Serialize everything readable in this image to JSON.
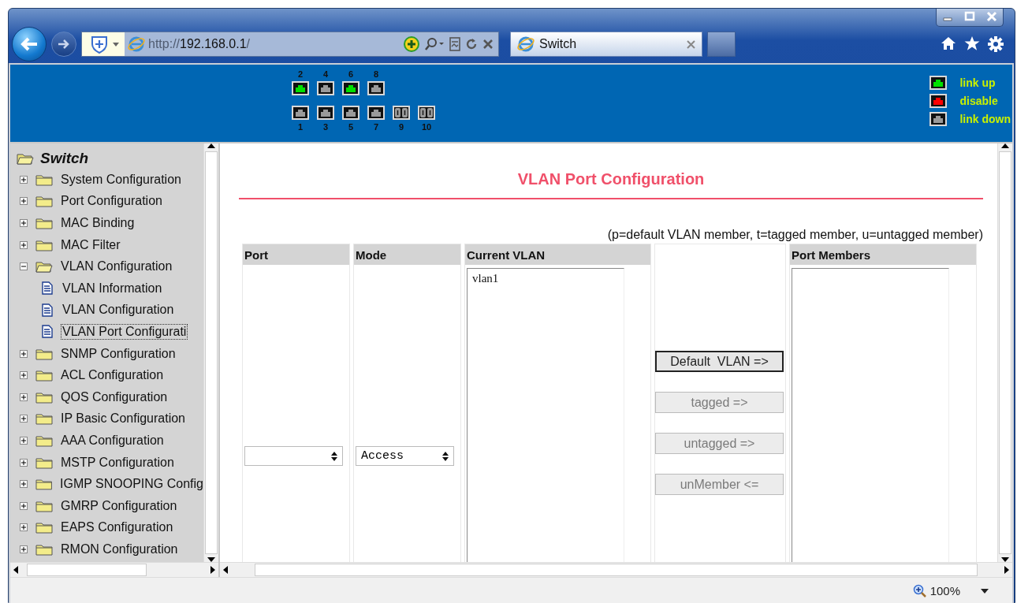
{
  "browser": {
    "address": {
      "scheme": "http://",
      "host": "192.168.0.1",
      "trail": "/"
    },
    "tab": {
      "title": "Switch"
    },
    "zoom": "100%"
  },
  "banner": {
    "ports_top": [
      {
        "label": "2",
        "color": "#00e000",
        "kind": "copper"
      },
      {
        "label": "4",
        "color": "#9a9a9a",
        "kind": "copper"
      },
      {
        "label": "6",
        "color": "#00e000",
        "kind": "copper"
      },
      {
        "label": "8",
        "color": "#9a9a9a",
        "kind": "copper"
      }
    ],
    "ports_bottom": [
      {
        "label": "1",
        "color": "#9a9a9a",
        "kind": "copper"
      },
      {
        "label": "3",
        "color": "#9a9a9a",
        "kind": "copper"
      },
      {
        "label": "5",
        "color": "#9a9a9a",
        "kind": "copper"
      },
      {
        "label": "7",
        "color": "#9a9a9a",
        "kind": "copper"
      },
      {
        "label": "9",
        "color": "#9a9a9a",
        "kind": "fiber"
      },
      {
        "label": "10",
        "color": "#9a9a9a",
        "kind": "fiber"
      }
    ],
    "legend": [
      {
        "color": "#00e000",
        "label": "link up"
      },
      {
        "color": "#ff0000",
        "label": "disable"
      },
      {
        "color": "#9a9a9a",
        "label": "link down"
      }
    ]
  },
  "sidebar": {
    "root": "Switch",
    "items": [
      {
        "label": "System Configuration",
        "expanded": false
      },
      {
        "label": "Port Configuration",
        "expanded": false
      },
      {
        "label": "MAC Binding",
        "expanded": false
      },
      {
        "label": "MAC Filter",
        "expanded": false
      },
      {
        "label": "VLAN Configuration",
        "expanded": true,
        "children": [
          {
            "label": "VLAN Information",
            "selected": false
          },
          {
            "label": "VLAN Configuration",
            "selected": false
          },
          {
            "label": "VLAN Port Configurati",
            "selected": true
          }
        ]
      },
      {
        "label": "SNMP Configuration",
        "expanded": false
      },
      {
        "label": "ACL Configuration",
        "expanded": false
      },
      {
        "label": "QOS Configuration",
        "expanded": false
      },
      {
        "label": "IP Basic Configuration",
        "expanded": false
      },
      {
        "label": "AAA Configuration",
        "expanded": false
      },
      {
        "label": "MSTP Configuration",
        "expanded": false
      },
      {
        "label": "IGMP SNOOPING Config",
        "expanded": false
      },
      {
        "label": "GMRP Configuration",
        "expanded": false
      },
      {
        "label": "EAPS Configuration",
        "expanded": false
      },
      {
        "label": "RMON Configuration",
        "expanded": false
      }
    ]
  },
  "main": {
    "title": "VLAN Port Configuration",
    "note": "(p=default VLAN member, t=tagged member, u=untagged member)",
    "columns": [
      "Port",
      "Mode",
      "Current VLAN",
      "Port Members"
    ],
    "mode_select": {
      "value": "Access"
    },
    "current_vlans": [
      "vlan1"
    ],
    "buttons": [
      {
        "label": "Default  VLAN =>",
        "disabled": false
      },
      {
        "label": "tagged =>",
        "disabled": true
      },
      {
        "label": "untagged =>",
        "disabled": true
      },
      {
        "label": "unMember <=",
        "disabled": true
      }
    ]
  }
}
